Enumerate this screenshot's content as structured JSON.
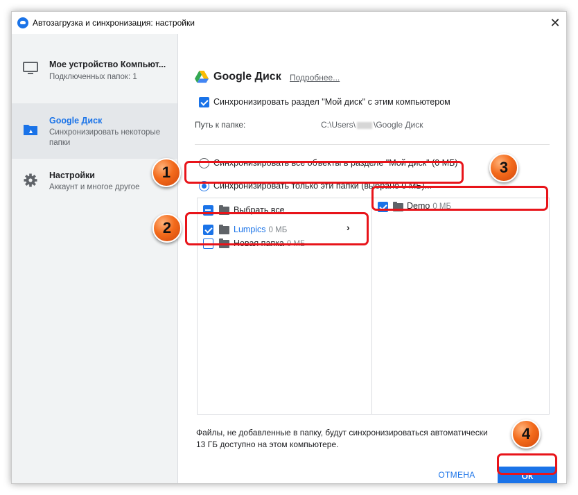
{
  "window": {
    "title": "Автозагрузка и синхронизация: настройки",
    "close_glyph": "✕"
  },
  "sidebar": {
    "items": [
      {
        "title": "Мое устройство Компьют...",
        "subtitle": "Подключенных папок: 1",
        "icon": "monitor-icon"
      },
      {
        "title": "Google Диск",
        "subtitle": "Синхронизировать некоторые папки",
        "icon": "drive-folder-icon"
      },
      {
        "title": "Настройки",
        "subtitle": "Аккаунт и многое другое",
        "icon": "gear-icon"
      }
    ]
  },
  "content": {
    "header_title": "Google Диск",
    "more_link": "Подробнее...",
    "sync_checkbox_label": "Синхронизировать раздел \"Мой диск\" с этим компьютером",
    "path_label": "Путь к папке:",
    "path_prefix": "C:\\Users\\",
    "path_suffix": "\\Google Диск",
    "radio_all": "Синхронизировать все объекты в разделе \"Мой диск\" (0 МБ)",
    "radio_only": "Синхронизировать только эти папки (выбрано 0 МБ)...",
    "tree": {
      "select_all": "Выбрать все",
      "left_items": [
        {
          "name": "Lumpics",
          "size": "0 МБ",
          "checked": true
        },
        {
          "name": "Новая папка",
          "size": "0 МБ",
          "checked": false
        }
      ],
      "right_items": [
        {
          "name": "Demo",
          "size": "0 МБ",
          "checked": true
        }
      ],
      "chevron": "›"
    },
    "footer_line1": "Файлы, не добавленные в папку, будут синхронизироваться автоматически",
    "footer_line2": "13 ГБ доступно на этом компьютере.",
    "cancel_label": "ОТМЕНА",
    "ok_label": "ОК"
  },
  "annotations": {
    "badges": [
      "1",
      "2",
      "3",
      "4"
    ],
    "color": "#e8141a"
  },
  "colors": {
    "accent": "#1a73e8",
    "sidebar_bg": "#f1f3f4",
    "highlight": "#e8141a"
  }
}
